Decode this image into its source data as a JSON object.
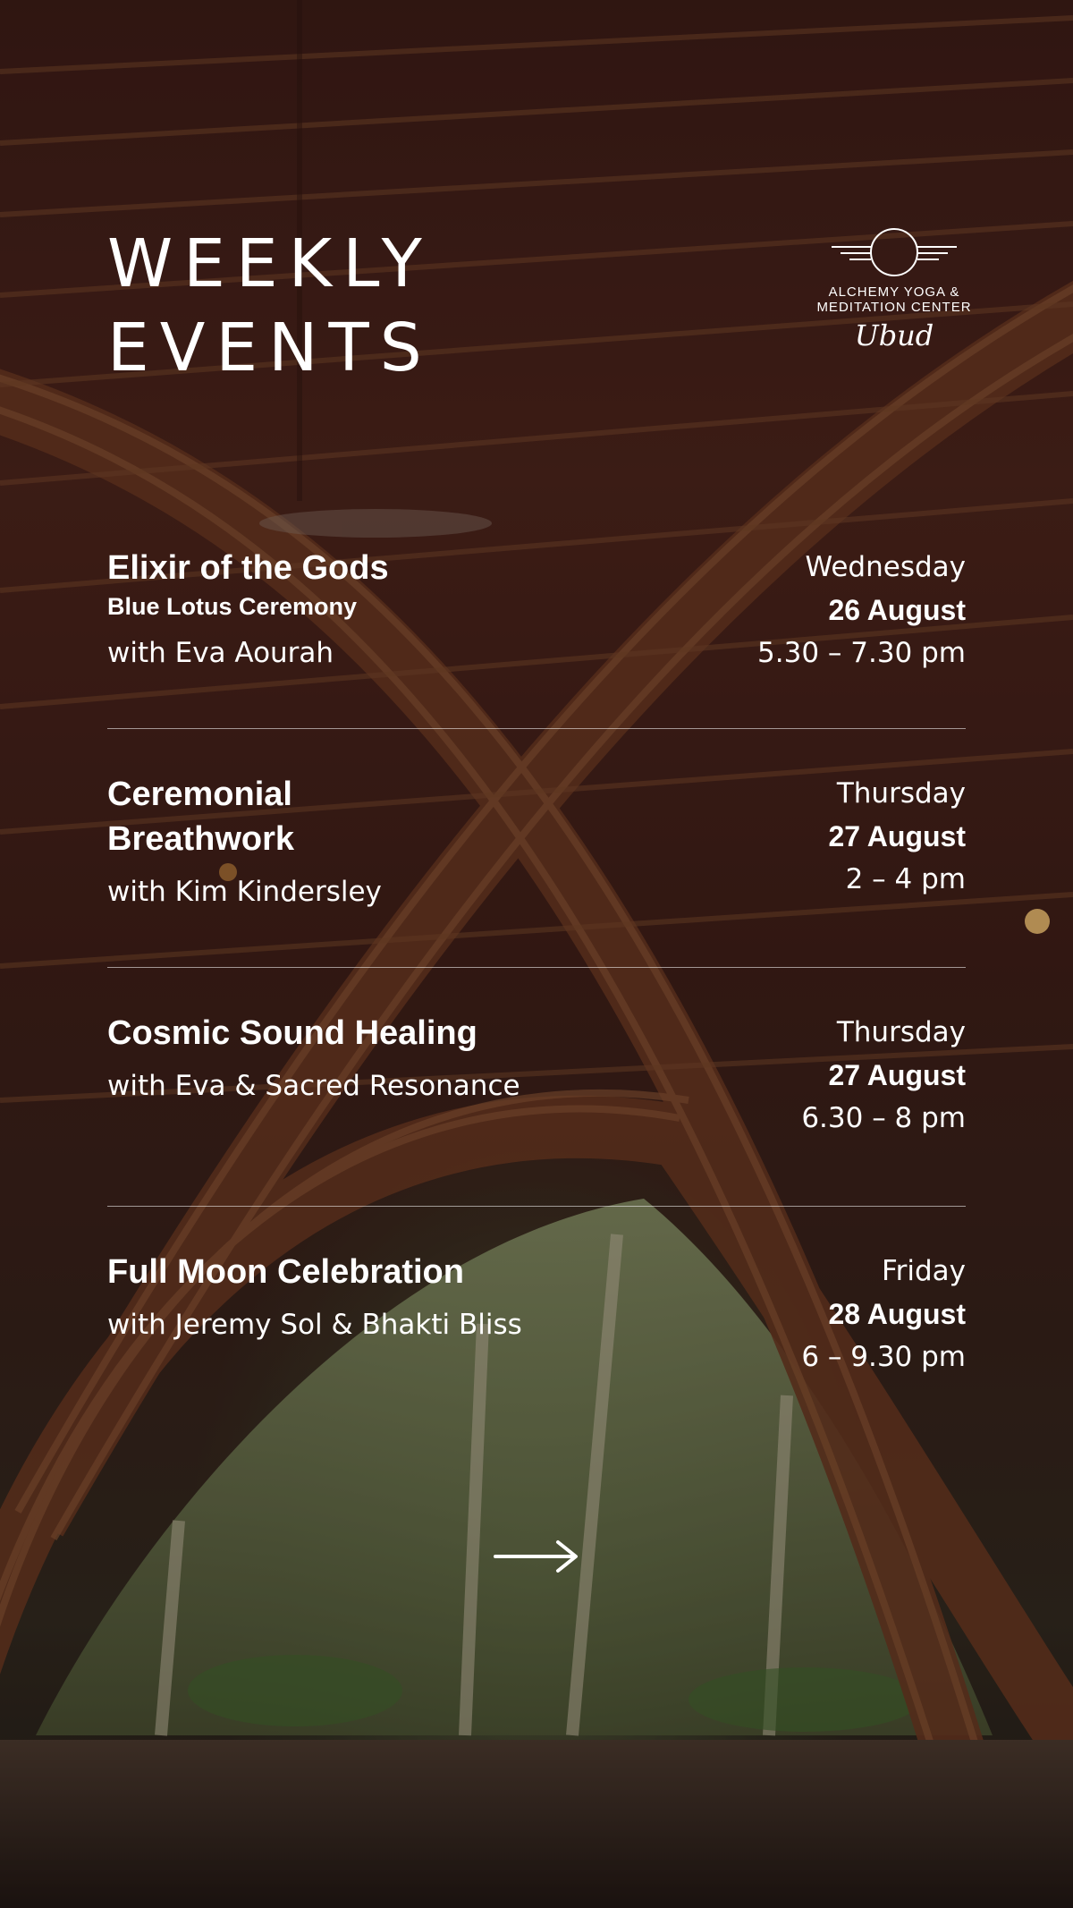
{
  "header": {
    "title_line1": "WEEKLY",
    "title_line2": "EVENTS"
  },
  "logo": {
    "icon": "sun-horizon-icon",
    "name_line1": "ALCHEMY YOGA &",
    "name_line2": "MEDITATION CENTER",
    "script": "Ubud"
  },
  "events": [
    {
      "title": "Elixir of the Gods",
      "subtitle": "Blue Lotus Ceremony",
      "host": "with Eva Aourah",
      "day": "Wednesday",
      "date": "26 August",
      "time": "5.30 – 7.30 pm"
    },
    {
      "title_line1": "Ceremonial",
      "title_line2": "Breathwork",
      "host": "with Kim Kindersley",
      "day": "Thursday",
      "date": "27 August",
      "time": "2 – 4 pm"
    },
    {
      "title": "Cosmic Sound Healing",
      "host": "with Eva & Sacred Resonance",
      "day": "Thursday",
      "date": "27 August",
      "time": "6.30 – 8 pm"
    },
    {
      "title": "Full Moon Celebration",
      "host": "with Jeremy Sol & Bhakti Bliss",
      "day": "Friday",
      "date": "28 August",
      "time": "6 – 9.30 pm"
    }
  ],
  "navigation": {
    "next_icon": "right-arrow-icon"
  }
}
